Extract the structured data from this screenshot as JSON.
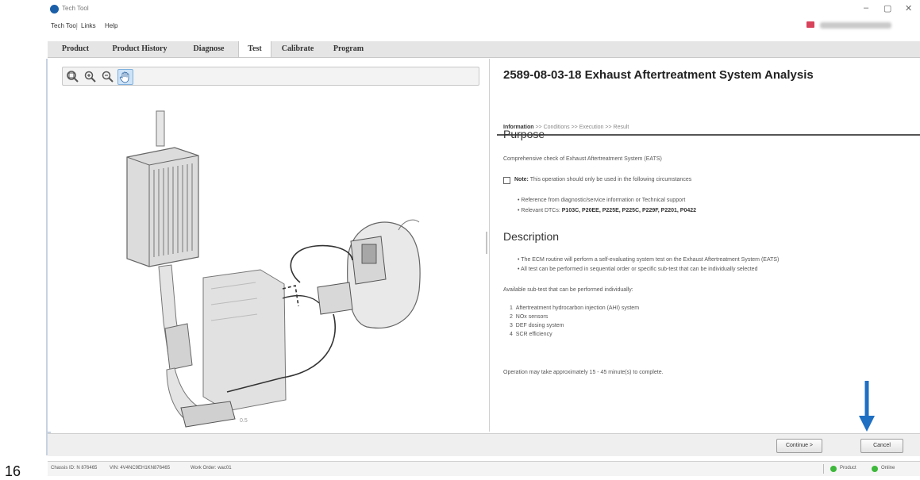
{
  "page_number": "16",
  "window": {
    "title": "Tech Tool",
    "controls": {
      "minimize": "–",
      "maximize": "▢",
      "close": "✕"
    }
  },
  "menu": {
    "items": [
      "Tech Tool",
      "Links",
      "Help"
    ]
  },
  "tabs": [
    "Product",
    "Product History",
    "Diagnose",
    "Test",
    "Calibrate",
    "Program"
  ],
  "active_tab": "Test",
  "toolbar": {
    "tools": [
      "zoom-fit-icon",
      "zoom-in-icon",
      "zoom-out-icon",
      "pan-hand-icon"
    ]
  },
  "operation": {
    "title": "2589-08-03-18 Exhaust Aftertreatment System Analysis",
    "breadcrumb": {
      "current": "Information",
      "rest": ">> Conditions >> Execution >> Result"
    },
    "purpose_heading": "Purpose",
    "purpose_text": "Comprehensive check of Exhaust Aftertreatment System (EATS)",
    "note_label": "Note:",
    "note_text": "This operation should only be used in the following circumstances",
    "circumstances": {
      "item1": "Reference from diagnostic/service information or Technical support",
      "item2_label": "Relevant DTCs:",
      "item2_codes": "P103C, P20EE, P225E, P225C, P229F, P2201, P0422"
    },
    "description_heading": "Description",
    "description_items": [
      "The ECM routine will perform a self-evaluating system test on the Exhaust Aftertreatment System (EATS)",
      "All test can be performed in sequential order or specific sub-test that can be individually selected"
    ],
    "subtests_intro": "Available sub-test that can be performed individually:",
    "subtests": [
      {
        "num": "1",
        "name": "Aftertreatment hydrocarbon injection (AHI) system"
      },
      {
        "num": "2",
        "name": "NOx sensors"
      },
      {
        "num": "3",
        "name": "DEF dosing system"
      },
      {
        "num": "4",
        "name": "SCR efficiency"
      }
    ],
    "duration_text": "Operation may take approximately 15 - 45 minute(s) to complete."
  },
  "buttons": {
    "continue": "Continue >",
    "cancel": "Cancel"
  },
  "status": {
    "chassis": "Chassis ID: N 876465",
    "vin": "VIN: 4V4NC9EH1KN876465",
    "work_order": "Work Order: wac01",
    "product": "Product",
    "online": "Online"
  },
  "colors": {
    "arrow": "#1f6fc3",
    "status_ok": "#3db83a",
    "accent_icon": "#1a5fa8"
  }
}
